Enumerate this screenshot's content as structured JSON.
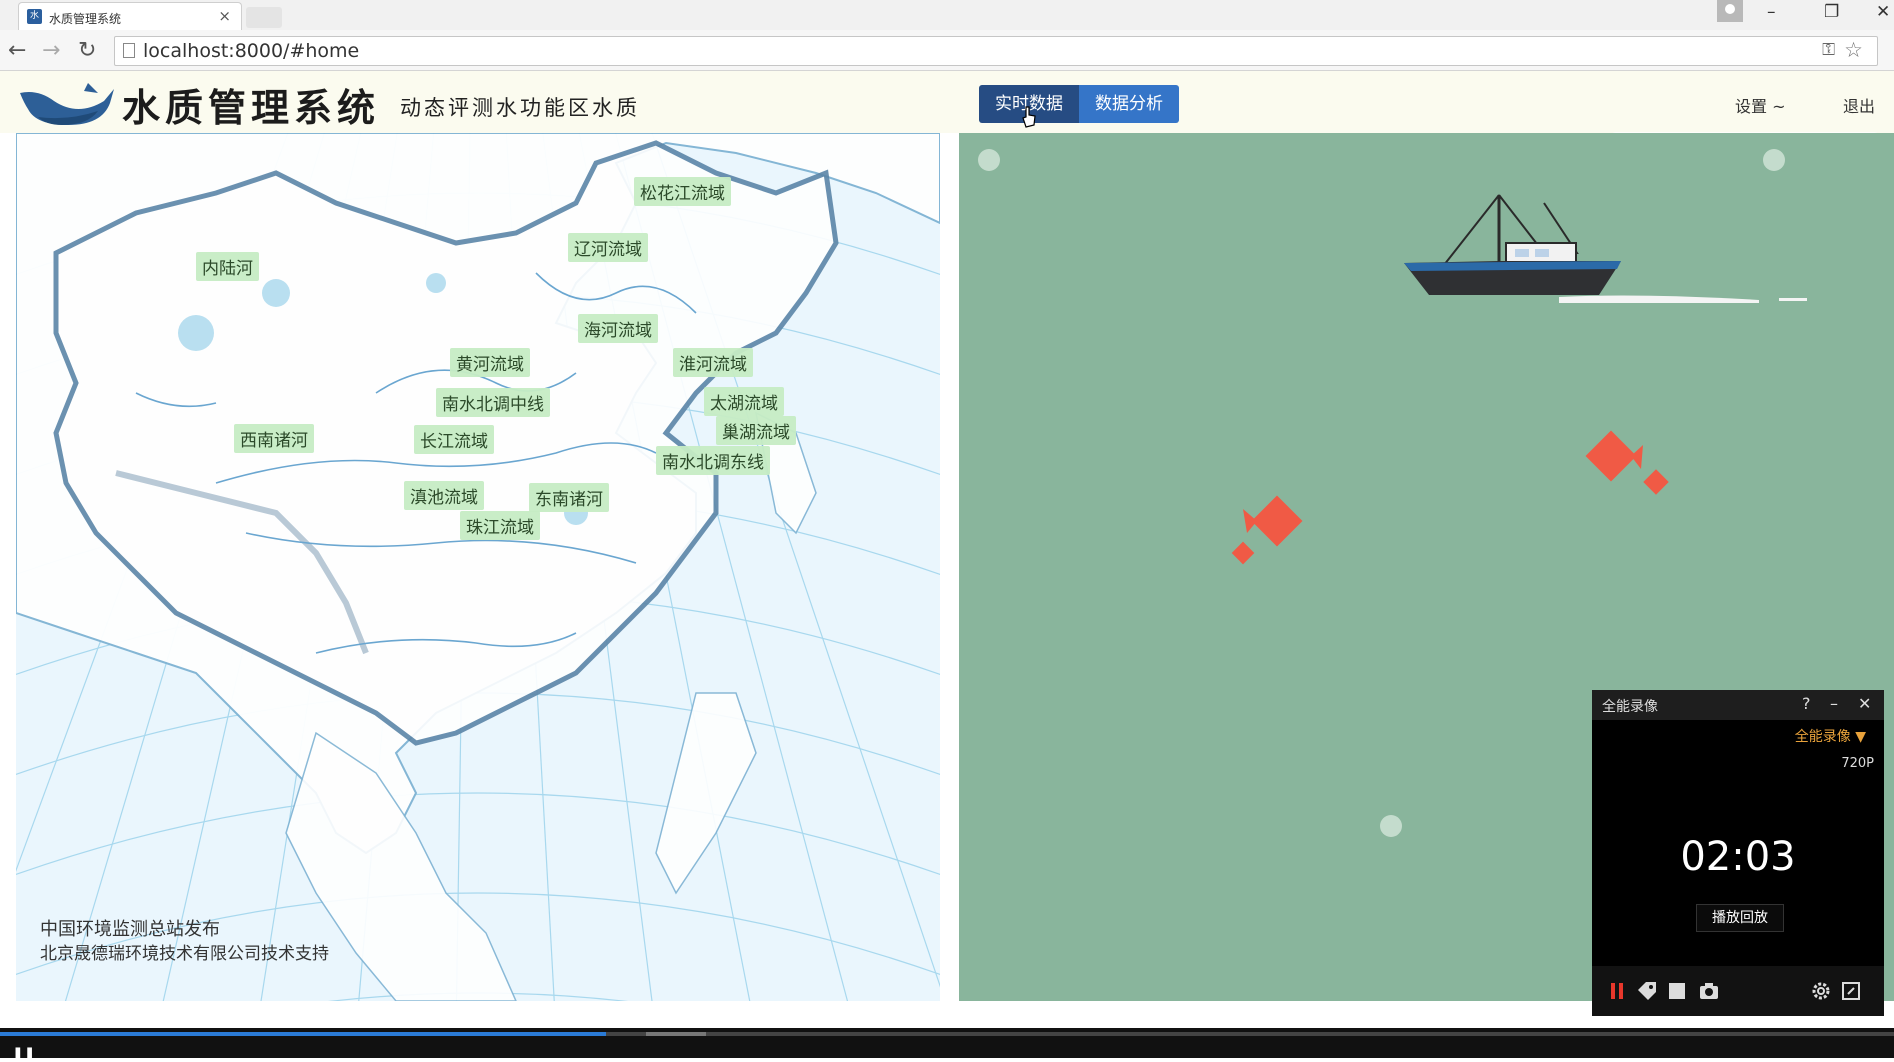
{
  "browser": {
    "tab_title": "水质管理系统",
    "tab_favicon_text": "水",
    "url": "localhost:8000/#home"
  },
  "header": {
    "title": "水质管理系统",
    "subtitle": "动态评测水功能区水质",
    "nav_buttons": [
      {
        "label": "实时数据",
        "active": true
      },
      {
        "label": "数据分析",
        "active": false
      }
    ],
    "settings_label": "设置 ~",
    "user_label": "退出"
  },
  "map": {
    "basins": [
      {
        "label": "松花江流域"
      },
      {
        "label": "辽河流域"
      },
      {
        "label": "内陆河"
      },
      {
        "label": "海河流域"
      },
      {
        "label": "黄河流域"
      },
      {
        "label": "淮河流域"
      },
      {
        "label": "南水北调中线"
      },
      {
        "label": "太湖流域"
      },
      {
        "label": "西南诸河"
      },
      {
        "label": "长江流域"
      },
      {
        "label": "巢湖流域"
      },
      {
        "label": "南水北调东线"
      },
      {
        "label": "滇池流域"
      },
      {
        "label": "东南诸河"
      },
      {
        "label": "珠江流域"
      }
    ],
    "credit_line1": "中国环境监测总站发布",
    "credit_line2": "北京晟德瑞环境技术有限公司技术支持"
  },
  "recorder": {
    "title": "全能录像",
    "mode": "全能录像 ▼",
    "resolution": "720P",
    "time": "02:03",
    "playback_label": "播放回放"
  },
  "colors": {
    "aquarium_bg": "#89b59c",
    "fish": "#f05a45",
    "nav_active": "#264c83",
    "nav_normal": "#3575c8",
    "header_bg": "#fbfbef",
    "map_water": "#eaf6fd"
  },
  "player": {
    "progress_fraction": 0.32
  }
}
